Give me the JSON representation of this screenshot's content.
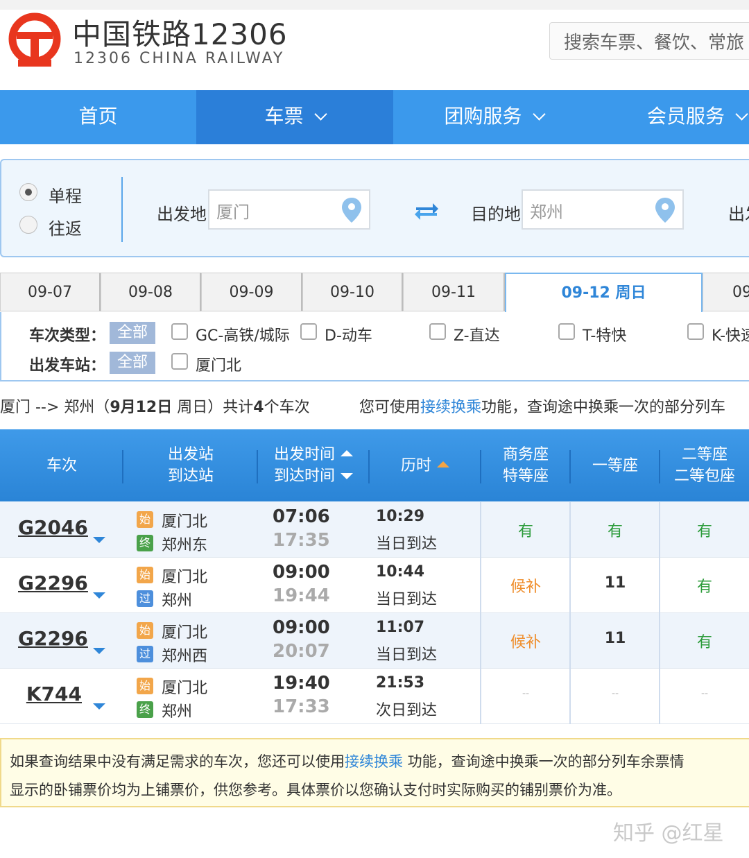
{
  "header": {
    "brand_cn": "中国铁路12306",
    "brand_en": "12306 CHINA RAILWAY",
    "search_placeholder": "搜索车票、餐饮、常旅"
  },
  "nav": {
    "items": [
      {
        "label": "首页",
        "active": false
      },
      {
        "label": "车票",
        "active": true
      },
      {
        "label": "团购服务",
        "active": false
      },
      {
        "label": "会员服务",
        "active": false
      }
    ]
  },
  "form": {
    "trip_one_way": "单程",
    "trip_round": "往返",
    "from_label": "出发地",
    "from_value": "厦门",
    "to_label": "目的地",
    "to_value": "郑州",
    "date_label": "出发"
  },
  "dates": [
    "09-07",
    "09-08",
    "09-09",
    "09-10",
    "09-11",
    "09-12 周日",
    "09"
  ],
  "filters": {
    "type_label": "车次类型：",
    "station_label": "出发车站：",
    "all": "全部",
    "types": [
      "GC-高铁/城际",
      "D-动车",
      "Z-直达",
      "T-特快",
      "K-快速"
    ],
    "stations": [
      "厦门北"
    ]
  },
  "summary": {
    "route": "厦门 --> 郑州（",
    "date": "9月12日",
    "weekday": "  周日）共计",
    "count": "4",
    "suffix": "个车次",
    "tip_prefix": "您可使用",
    "tip_link": "接续换乘",
    "tip_suffix": "功能，查询途中换乘一次的部分列车"
  },
  "table": {
    "headers": {
      "train": "车次",
      "station1": "出发站",
      "station2": "到达站",
      "time1": "出发时间",
      "time2": "到达时间",
      "duration": "历时",
      "business1": "商务座",
      "business2": "特等座",
      "first": "一等座",
      "second1": "二等座",
      "second2": "二等包座"
    },
    "rows": [
      {
        "train": "G2046",
        "from_badge": "始",
        "from": "厦门北",
        "to_badge": "终",
        "to": "郑州东",
        "dep": "07:06",
        "arr": "17:35",
        "dur": "10:29",
        "arrive_day": "当日到达",
        "business": "有",
        "first": "有",
        "second": "有"
      },
      {
        "train": "G2296",
        "from_badge": "始",
        "from": "厦门北",
        "to_badge": "过",
        "to": "郑州",
        "dep": "09:00",
        "arr": "19:44",
        "dur": "10:44",
        "arrive_day": "当日到达",
        "business": "候补",
        "first": "11",
        "second": "有"
      },
      {
        "train": "G2296",
        "from_badge": "始",
        "from": "厦门北",
        "to_badge": "过",
        "to": "郑州西",
        "dep": "09:00",
        "arr": "20:07",
        "dur": "11:07",
        "arrive_day": "当日到达",
        "business": "候补",
        "first": "11",
        "second": "有"
      },
      {
        "train": "K744",
        "from_badge": "始",
        "from": "厦门北",
        "to_badge": "终",
        "to": "郑州",
        "dep": "19:40",
        "arr": "17:33",
        "dur": "21:53",
        "arrive_day": "次日到达",
        "business": "--",
        "first": "--",
        "second": "--"
      }
    ]
  },
  "notice": {
    "line1_prefix": "如果查询结果中没有满足需求的车次，您还可以使用",
    "line1_link": "接续换乘",
    "line1_suffix": " 功能，查询途中换乘一次的部分列车余票情",
    "line2": "显示的卧铺票价均为上铺票价，供您参考。具体票价以您确认支付时实际购买的铺别票价为准。"
  },
  "watermark": "知乎 @红星",
  "colors": {
    "nav": "#3b99ec",
    "nav_active": "#2b7fd9",
    "available": "#2b9b3a",
    "waitlist": "#ef8e2c",
    "logo": "#e8361e"
  }
}
